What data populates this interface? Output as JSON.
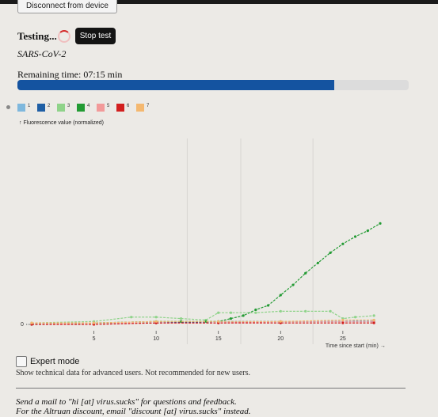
{
  "header": {
    "disconnect_label": "Disconnect from device",
    "status_label": "Testing...",
    "stop_label": "Stop test"
  },
  "test": {
    "name": "SARS-CoV-2",
    "remaining_text": "Remaining time: 07:15 min",
    "progress": 0.81
  },
  "legend": [
    {
      "label": "1",
      "color": "#7fb8dd"
    },
    {
      "label": "2",
      "color": "#1f5fa5"
    },
    {
      "label": "3",
      "color": "#8fd38a"
    },
    {
      "label": "4",
      "color": "#239b34"
    },
    {
      "label": "5",
      "color": "#f29a9a"
    },
    {
      "label": "6",
      "color": "#d21f1f"
    },
    {
      "label": "7",
      "color": "#f4b870"
    }
  ],
  "chart_data": {
    "type": "line",
    "ylabel": "↑ Fluorescence value (normalized)",
    "xlabel": "Time since start (min) →",
    "y_ticks": [
      "0"
    ],
    "x_ticks": [
      5,
      10,
      15,
      20,
      25
    ],
    "xlim": [
      0,
      28
    ],
    "ylim": [
      0,
      1.0
    ],
    "series": [
      {
        "name": "1",
        "color": "#7fb8dd",
        "x": [
          0,
          5,
          10,
          15,
          20,
          25,
          27.5
        ],
        "y": [
          0.01,
          0.01,
          0.02,
          0.02,
          0.02,
          0.02,
          0.03
        ]
      },
      {
        "name": "2",
        "color": "#1f5fa5",
        "x": [
          0,
          5,
          10,
          15,
          20,
          25,
          27.5
        ],
        "y": [
          0.0,
          0.01,
          0.01,
          0.02,
          0.02,
          0.02,
          0.02
        ]
      },
      {
        "name": "3",
        "color": "#8fd38a",
        "x": [
          0,
          5,
          8,
          10,
          12,
          14,
          15,
          16,
          18,
          20,
          22,
          24,
          25,
          26,
          27.5
        ],
        "y": [
          0.01,
          0.02,
          0.05,
          0.05,
          0.04,
          0.03,
          0.08,
          0.08,
          0.08,
          0.09,
          0.09,
          0.09,
          0.04,
          0.05,
          0.06
        ]
      },
      {
        "name": "4",
        "color": "#239b34",
        "x": [
          0,
          5,
          10,
          12,
          14,
          15,
          16,
          17,
          18,
          19,
          20,
          21,
          22,
          23,
          24,
          25,
          26,
          27,
          28
        ],
        "y": [
          0.0,
          0.01,
          0.02,
          0.02,
          0.02,
          0.02,
          0.04,
          0.06,
          0.1,
          0.13,
          0.2,
          0.27,
          0.35,
          0.42,
          0.49,
          0.55,
          0.6,
          0.64,
          0.69
        ]
      },
      {
        "name": "5",
        "color": "#f29a9a",
        "x": [
          0,
          5,
          10,
          15,
          20,
          25,
          27.5
        ],
        "y": [
          0.0,
          0.01,
          0.01,
          0.01,
          0.02,
          0.02,
          0.02
        ]
      },
      {
        "name": "6",
        "color": "#d21f1f",
        "x": [
          0,
          5,
          10,
          15,
          20,
          25,
          27.5
        ],
        "y": [
          0.0,
          0.0,
          0.01,
          0.01,
          0.01,
          0.01,
          0.01
        ]
      },
      {
        "name": "7",
        "color": "#f4b870",
        "x": [
          0,
          5,
          10,
          15,
          20,
          25,
          27.5
        ],
        "y": [
          0.01,
          0.01,
          0.02,
          0.02,
          0.02,
          0.03,
          0.03
        ]
      }
    ]
  },
  "expert": {
    "label": "Expert mode",
    "description": "Show technical data for advanced users. Not recommended for new users."
  },
  "footer": {
    "line1": "Send a mail to \"hi [at] virus.sucks\" for questions and feedback.",
    "line2": "For the Altruan discount, email \"discount [at] virus.sucks\" instead."
  }
}
